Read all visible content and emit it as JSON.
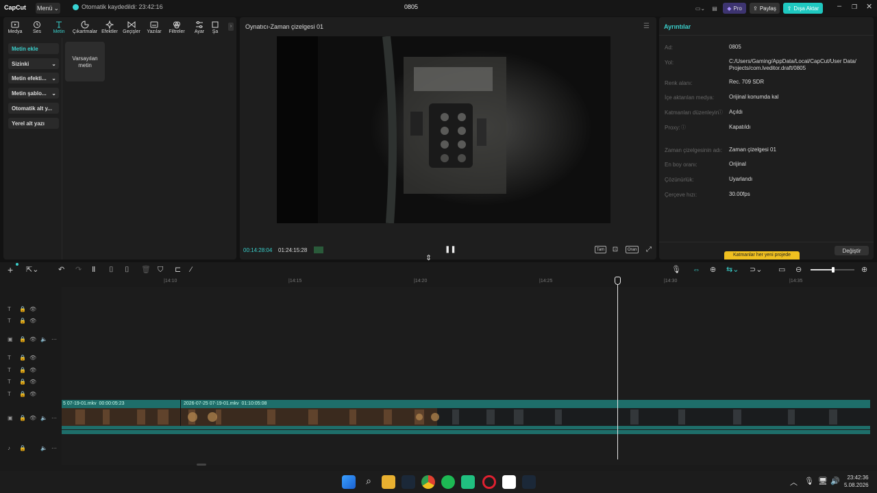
{
  "app": {
    "logo": "CapCut",
    "menu_label": "Menü",
    "autosave": "Otomatik kaydedildi: 23:42:16",
    "project_title": "0805",
    "pro_label": "Pro",
    "share_label": "Paylaş",
    "export_label": "Dışa Aktar"
  },
  "tabs": [
    {
      "label": "Medya",
      "icon": "media-icon"
    },
    {
      "label": "Ses",
      "icon": "audio-icon"
    },
    {
      "label": "Metin",
      "icon": "text-icon",
      "active": true
    },
    {
      "label": "Çıkartmalar",
      "icon": "sticker-icon"
    },
    {
      "label": "Efektler",
      "icon": "effects-icon"
    },
    {
      "label": "Geçişler",
      "icon": "transitions-icon"
    },
    {
      "label": "Yazılar",
      "icon": "captions-icon"
    },
    {
      "label": "Filtreler",
      "icon": "filters-icon"
    },
    {
      "label": "Ayar",
      "icon": "adjust-icon"
    },
    {
      "label": "Şa",
      "icon": "template-icon"
    }
  ],
  "sidebar": {
    "items": [
      {
        "label": "Metin ekle",
        "active": true
      },
      {
        "label": "Sizinki",
        "chevron": true
      },
      {
        "label": "Metin efekti...",
        "chevron": true
      },
      {
        "label": "Metin şablo...",
        "chevron": true
      },
      {
        "label": "Otomatik alt y..."
      },
      {
        "label": "Yerel alt yazı"
      }
    ]
  },
  "card": {
    "line1": "Varsayılan",
    "line2": "metin"
  },
  "player": {
    "title": "Oynatıcı-Zaman çizelgesi 01",
    "time_current": "00:14:28:04",
    "time_total": "01:24:15:28",
    "btn_full": "Tam",
    "btn_ratio": "Oran"
  },
  "details": {
    "title": "Ayrıntılar",
    "rows": [
      {
        "key": "Ad:",
        "value": "0805"
      },
      {
        "key": "Yol:",
        "value": "C:/Users/Gaming/AppData/Local/CapCut/User Data/",
        "value2": "Projects/com.lveditor.draft/0805"
      },
      {
        "key": "Renk alanı:",
        "value": "Rec. 709 SDR"
      },
      {
        "key": "İçe aktarılan medya:",
        "value": "Orijinal konumda kal"
      },
      {
        "key": "Katmanları düzenleyin",
        "value": "Açıldı"
      },
      {
        "key": "Proxy:",
        "value": "Kapatıldı"
      },
      {
        "key": "Zaman çizelgesinin adı:",
        "value": "Zaman çizelgesi 01"
      },
      {
        "key": "En boy oranı:",
        "value": "Orijinal"
      },
      {
        "key": "Çözünürlük:",
        "value": "Uyarlandı"
      },
      {
        "key": "Çerçeve hızı:",
        "value": "30.00fps"
      }
    ],
    "tip": "Katmanlar her yeni projede",
    "change_label": "Değiştir"
  },
  "timeline": {
    "ticks": [
      "|14:10",
      "|14:15",
      "|14:20",
      "|14:25",
      "|14:30",
      "|14:35"
    ],
    "clips": [
      {
        "name": "5 07-19-01.mkv",
        "duration": "00:00:05:23"
      },
      {
        "name": "2026-07-25 07-19-01.mkv",
        "duration": "01:10:05:08"
      }
    ]
  },
  "taskbar": {
    "time": "23:42:36",
    "date": "5.08.2026"
  },
  "colors": {
    "accent": "#3ad0cc",
    "clip_teal": "#1e6e6a",
    "export_btn": "#1fc8c0",
    "pro_badge": "#5a48c8"
  }
}
